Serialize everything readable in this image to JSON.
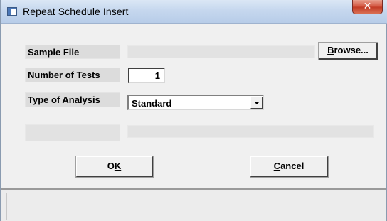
{
  "window": {
    "title": "Repeat Schedule Insert",
    "close_glyph": "✕"
  },
  "form": {
    "sample_file": {
      "label": "Sample File",
      "value": ""
    },
    "browse_button": {
      "pre": "",
      "accel": "B",
      "post": "rowse..."
    },
    "number_of_tests": {
      "label": "Number of Tests",
      "value": "1"
    },
    "type_of_analysis": {
      "label": "Type of Analysis",
      "selected": "Standard"
    },
    "ok_button": {
      "pre": "O",
      "accel": "K",
      "post": ""
    },
    "cancel_button": {
      "pre": "",
      "accel": "C",
      "post": "ancel"
    }
  },
  "status": {
    "text": ""
  },
  "colors": {
    "title_bar": "#c5d7ee",
    "close_button": "#c8432d",
    "dialog_face": "#f0f0f0"
  },
  "icons": {
    "app": "app-window-icon",
    "close": "close-icon",
    "dropdown": "chevron-down-icon"
  }
}
